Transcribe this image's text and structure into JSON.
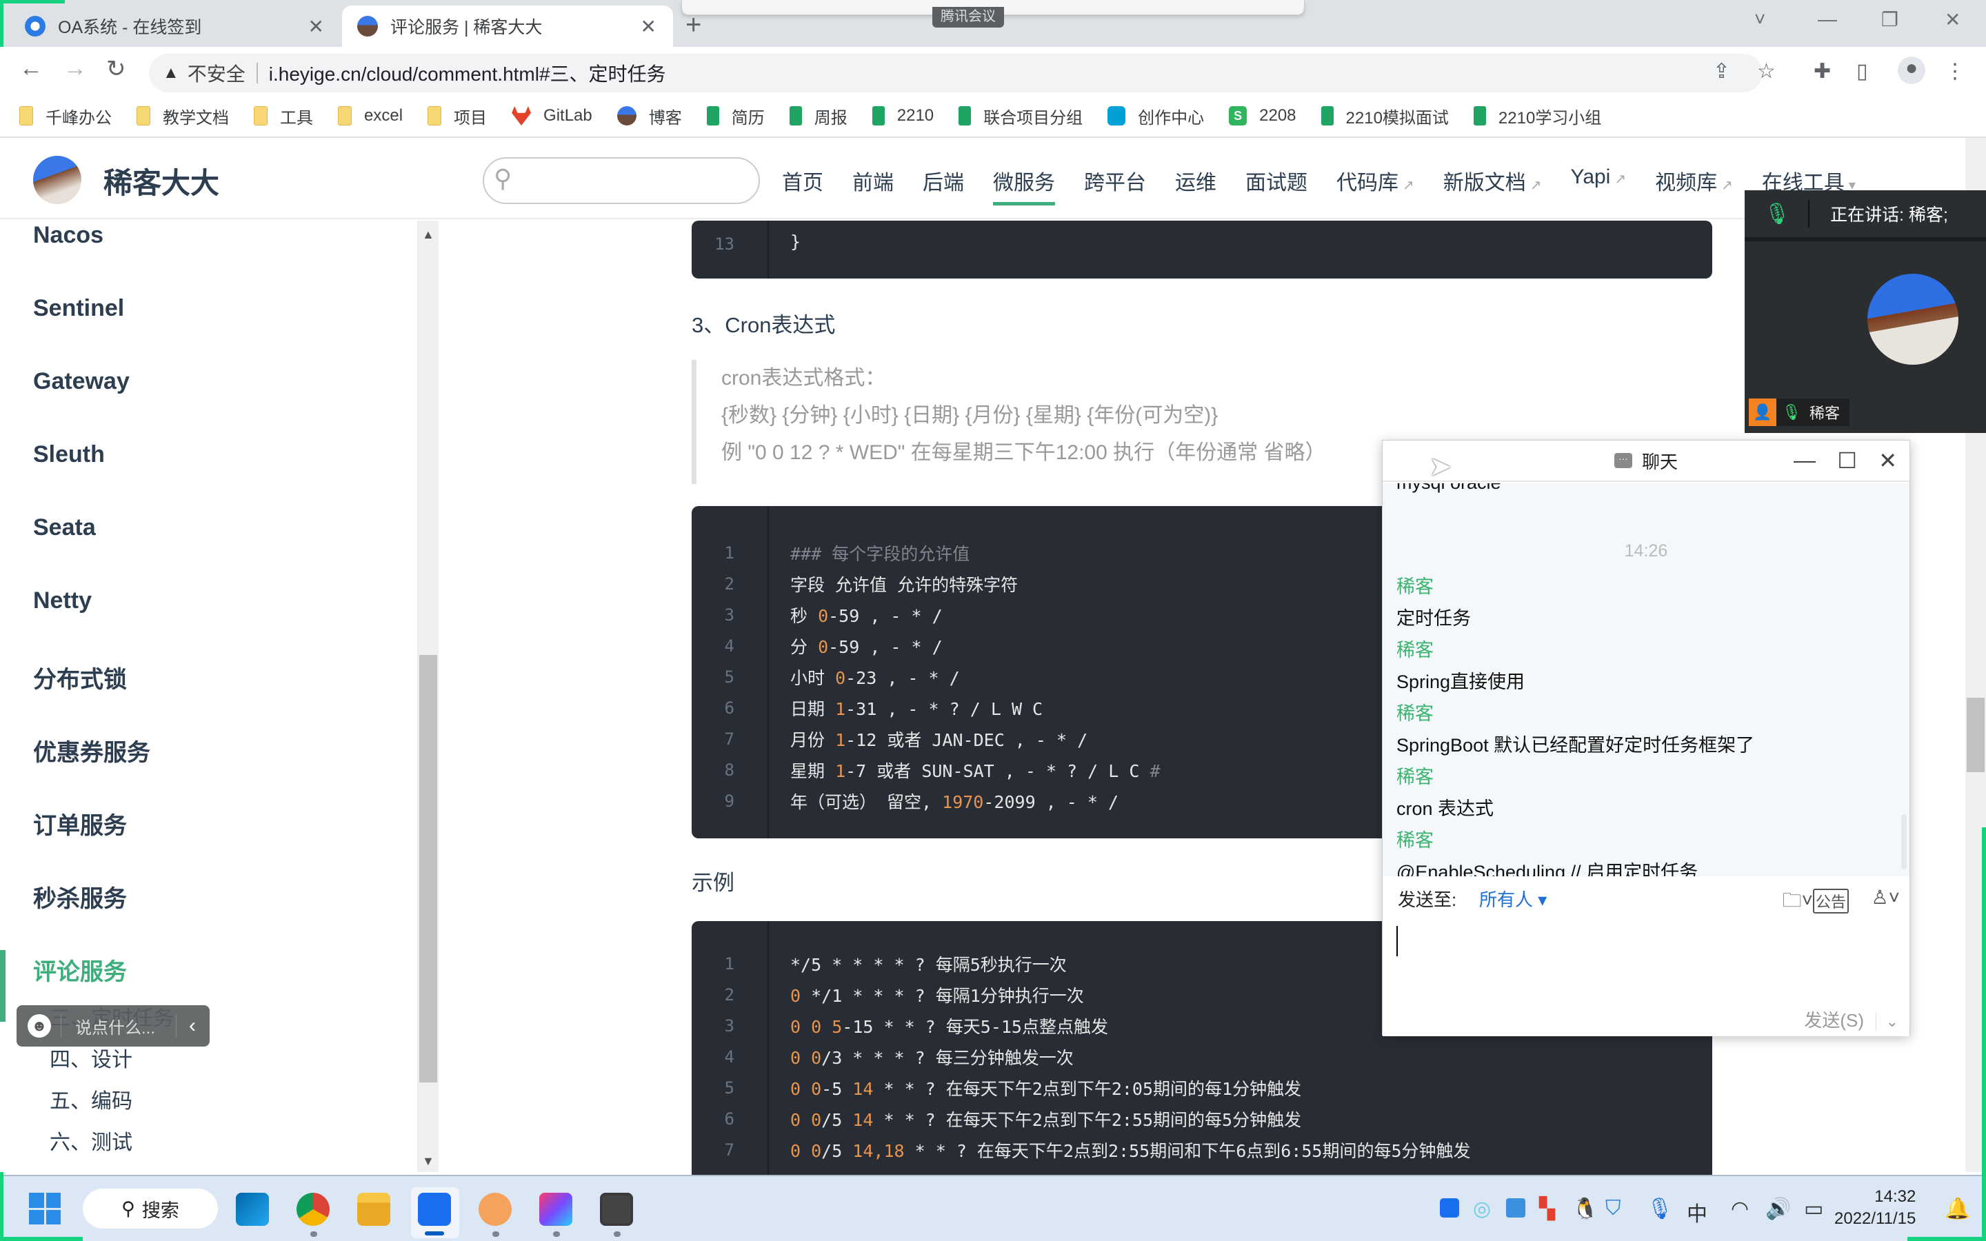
{
  "browser": {
    "tabs": [
      {
        "title": "OA系统 - 在线签到",
        "active": false
      },
      {
        "title": "评论服务 | 稀客大大",
        "active": true
      }
    ],
    "new_tab_icon": "plus-icon",
    "meeting_badge": "腾讯会议",
    "window_controls": {
      "tab_search": "˅",
      "minimize": "—",
      "restore": "❐",
      "close": "✕"
    },
    "nav": {
      "back": "←",
      "forward": "→",
      "reload": "↻"
    },
    "address": {
      "security_icon": "▲",
      "security_label": "不安全",
      "url": "i.heyige.cn/cloud/comment.html#三、定时任务"
    },
    "bookmarks": [
      {
        "label": "千峰办公",
        "icon": "folder"
      },
      {
        "label": "教学文档",
        "icon": "folder"
      },
      {
        "label": "工具",
        "icon": "folder"
      },
      {
        "label": "excel",
        "icon": "folder"
      },
      {
        "label": "项目",
        "icon": "folder"
      },
      {
        "label": "GitLab",
        "icon": "gitlab"
      },
      {
        "label": "博客",
        "icon": "avatar"
      },
      {
        "label": "简历",
        "icon": "sheet"
      },
      {
        "label": "周报",
        "icon": "sheet"
      },
      {
        "label": "2210",
        "icon": "sheet"
      },
      {
        "label": "联合项目分组",
        "icon": "sheet"
      },
      {
        "label": "创作中心",
        "icon": "bili"
      },
      {
        "label": "2208",
        "icon": "s"
      },
      {
        "label": "2210模拟面试",
        "icon": "sheet"
      },
      {
        "label": "2210学习小组",
        "icon": "sheet"
      }
    ]
  },
  "site": {
    "name": "稀客大大",
    "search_placeholder": "",
    "nav": [
      {
        "label": "首页"
      },
      {
        "label": "前端"
      },
      {
        "label": "后端"
      },
      {
        "label": "微服务",
        "active": true
      },
      {
        "label": "跨平台"
      },
      {
        "label": "运维"
      },
      {
        "label": "面试题"
      },
      {
        "label": "代码库",
        "external": true
      },
      {
        "label": "新版文档",
        "external": true
      },
      {
        "label": "Yapi",
        "external": true
      },
      {
        "label": "视频库",
        "external": true
      },
      {
        "label": "在线工具",
        "dropdown": true
      }
    ],
    "external_glyph": "↗",
    "dropdown_glyph": "▾"
  },
  "sidebar": {
    "items": [
      "Nacos",
      "Sentinel",
      "Gateway",
      "Sleuth",
      "Seata",
      "Netty",
      "分布式锁",
      "优惠券服务",
      "订单服务",
      "秒杀服务",
      "评论服务"
    ],
    "active": "评论服务",
    "subitems": [
      "三、定时任务",
      "四、设计",
      "五、编码",
      "六、测试"
    ]
  },
  "content": {
    "top_code": {
      "line_no": "13",
      "text": "}"
    },
    "heading": "3、Cron表达式",
    "quote": [
      "cron表达式格式：",
      "{秒数} {分钟} {小时} {日期} {月份} {星期} {年份(可为空)}",
      "例 \"0 0 12 ? * WED\" 在每星期三下午12:00 执行（年份通常 省略）"
    ],
    "fields_code": [
      {
        "n": "1",
        "parts": [
          {
            "t": "### 每个字段的允许值",
            "k": "c"
          }
        ]
      },
      {
        "n": "2",
        "parts": [
          {
            "t": "字段 允许值 允许的特殊字符"
          }
        ]
      },
      {
        "n": "3",
        "parts": [
          {
            "t": "秒 "
          },
          {
            "t": "0",
            "k": "n"
          },
          {
            "t": "-59 , - * /"
          }
        ]
      },
      {
        "n": "4",
        "parts": [
          {
            "t": "分 "
          },
          {
            "t": "0",
            "k": "n"
          },
          {
            "t": "-59 , - * /"
          }
        ]
      },
      {
        "n": "5",
        "parts": [
          {
            "t": "小时 "
          },
          {
            "t": "0",
            "k": "n"
          },
          {
            "t": "-23 , - * /"
          }
        ]
      },
      {
        "n": "6",
        "parts": [
          {
            "t": "日期 "
          },
          {
            "t": "1",
            "k": "n"
          },
          {
            "t": "-31 , - * ? / L W C"
          }
        ]
      },
      {
        "n": "7",
        "parts": [
          {
            "t": "月份 "
          },
          {
            "t": "1",
            "k": "n"
          },
          {
            "t": "-12 或者 JAN-DEC , - * /"
          }
        ]
      },
      {
        "n": "8",
        "parts": [
          {
            "t": "星期 "
          },
          {
            "t": "1",
            "k": "n"
          },
          {
            "t": "-7 或者 SUN-SAT , - * ? / L C "
          },
          {
            "t": "#",
            "k": "c"
          }
        ]
      },
      {
        "n": "9",
        "parts": [
          {
            "t": "年（可选） 留空, "
          },
          {
            "t": "1970",
            "k": "n"
          },
          {
            "t": "-2099 , - * /"
          }
        ]
      }
    ],
    "example_heading": "示例",
    "example_code": [
      {
        "n": "1",
        "parts": [
          {
            "t": "*/5 * * * * ? 每隔5秒执行一次"
          }
        ]
      },
      {
        "n": "2",
        "parts": [
          {
            "t": "0",
            "k": "n"
          },
          {
            "t": " */1 * * * ? 每隔1分钟执行一次"
          }
        ]
      },
      {
        "n": "3",
        "parts": [
          {
            "t": "0 0 5",
            "k": "n"
          },
          {
            "t": "-15 * * ? 每天5-15点整点触发"
          }
        ]
      },
      {
        "n": "4",
        "parts": [
          {
            "t": "0 0",
            "k": "n"
          },
          {
            "t": "/3 * * * ? 每三分钟触发一次"
          }
        ]
      },
      {
        "n": "5",
        "parts": [
          {
            "t": "0 0",
            "k": "n"
          },
          {
            "t": "-5 "
          },
          {
            "t": "14",
            "k": "n"
          },
          {
            "t": " * * ? 在每天下午2点到下午2:05期间的每1分钟触发"
          }
        ]
      },
      {
        "n": "6",
        "parts": [
          {
            "t": "0 0",
            "k": "n"
          },
          {
            "t": "/5 "
          },
          {
            "t": "14",
            "k": "n"
          },
          {
            "t": " * * ? 在每天下午2点到下午2:55期间的每5分钟触发"
          }
        ]
      },
      {
        "n": "7",
        "parts": [
          {
            "t": "0 0",
            "k": "n"
          },
          {
            "t": "/5 "
          },
          {
            "t": "14,18",
            "k": "n"
          },
          {
            "t": " * * ? 在每天下午2点到2:55期间和下午6点到6:55期间的每5分钟触发"
          }
        ]
      }
    ]
  },
  "meeting": {
    "speaking_label": "正在讲话: 稀客;",
    "participant": "稀客"
  },
  "chat": {
    "title": "聊天",
    "partial_top": "mysql  oracle",
    "time": "14:26",
    "messages": [
      {
        "sender": "稀客",
        "text": "定时任务"
      },
      {
        "sender": "稀客",
        "text": "Spring直接使用"
      },
      {
        "sender": "稀客",
        "text": "SpringBoot 默认已经配置好定时任务框架了"
      },
      {
        "sender": "稀客",
        "text": "cron 表达式"
      },
      {
        "sender": "稀客",
        "text": "@EnableScheduling // 启用定时任务"
      }
    ],
    "send_to_label": "发送至:",
    "send_to_value": "所有人 ▾",
    "input_value": "",
    "send_button": "发送(S)",
    "send_more": "⌄"
  },
  "danmu": {
    "placeholder": "说点什么...",
    "collapse": "‹"
  },
  "taskbar": {
    "search_label": "搜索",
    "apps": [
      "vscode",
      "chrome",
      "file-explorer",
      "tencent-meeting",
      "toolbox",
      "intellij-idea",
      "sublime-text"
    ],
    "ime": "中",
    "time": "14:32",
    "date": "2022/11/15"
  }
}
